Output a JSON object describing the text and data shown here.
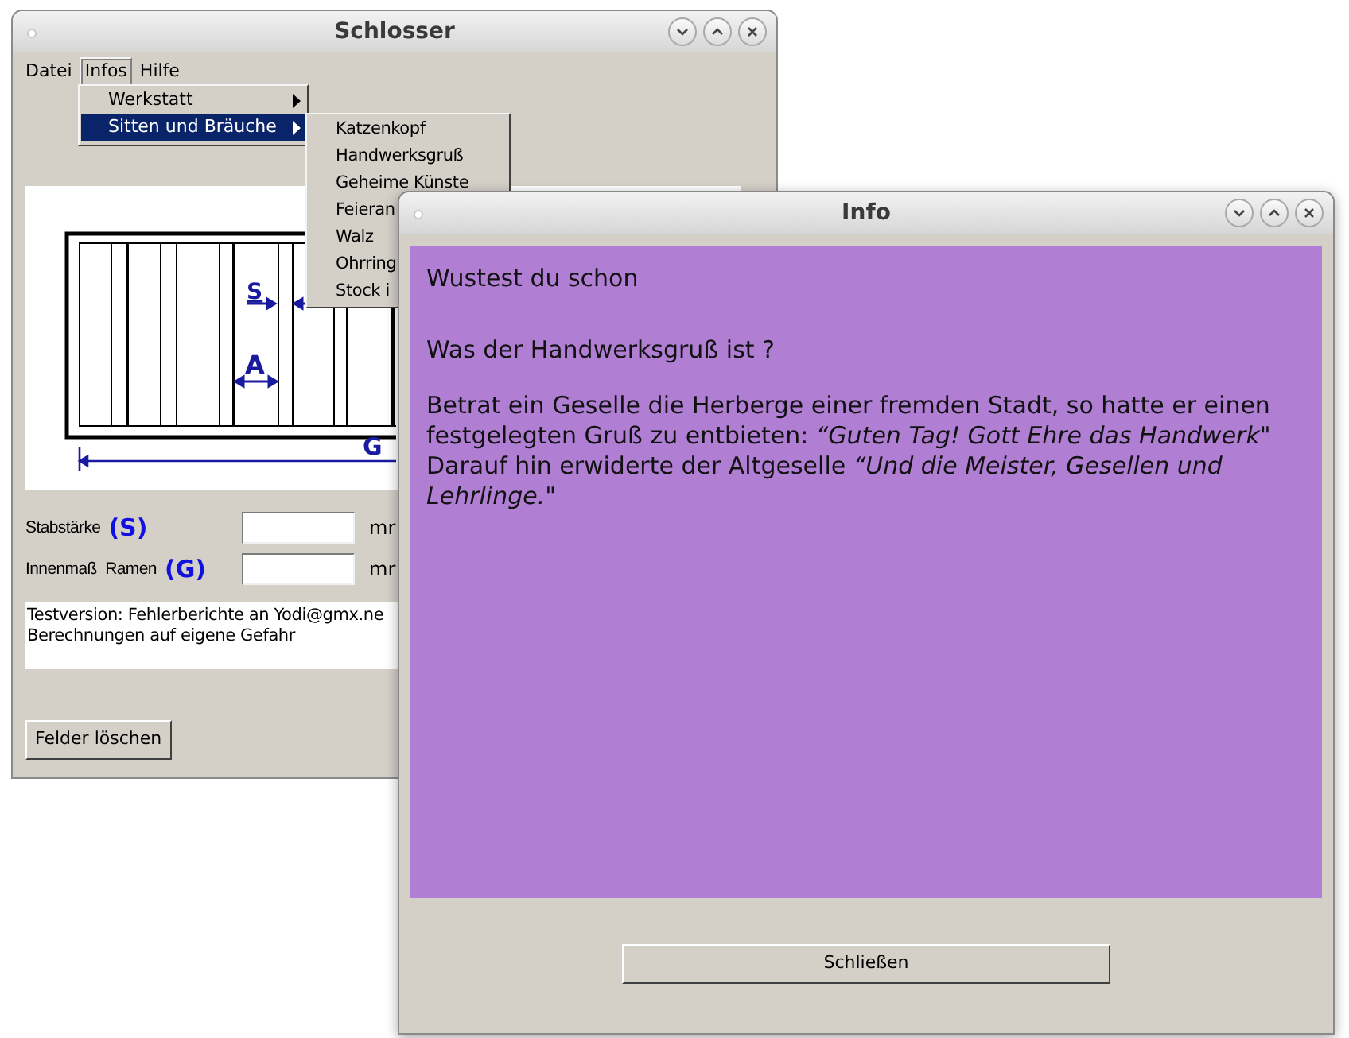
{
  "main_window": {
    "title": "Schlosser",
    "menu_bar": [
      {
        "label": "Datei",
        "selected": false
      },
      {
        "label": "Infos",
        "selected": true
      },
      {
        "label": "Hilfe",
        "selected": false
      }
    ],
    "menu": [
      {
        "label": "Werkstatt",
        "selected": false
      },
      {
        "label": "Sitten und Bräuche",
        "selected": true
      }
    ],
    "submenu": [
      "Katzenkopf",
      "Handwerksgruß",
      "Geheime Künste",
      "Feieran",
      "Walz",
      "Ohrring",
      "Stock i"
    ],
    "diagram": {
      "labels": [
        "S",
        "A",
        "G"
      ]
    },
    "fields": [
      {
        "label": "Stabstärke",
        "symbol": "(S)",
        "unit": "mr"
      },
      {
        "label": "Innenmaß  Ramen",
        "symbol": "(G)",
        "unit": "mr"
      }
    ],
    "notice": [
      "Testversion: Fehlerberichte an Yodi@gmx.ne",
      "Berechnungen auf eigene Gefahr"
    ],
    "button": "Felder löschen"
  },
  "info_window": {
    "title": "Info",
    "heading": "Wustest du schon",
    "question": "Was der Handwerksgruß ist ?",
    "paragraph": "Betrat ein Geselle die Herberge einer fremden Stadt, so hatte er einen festgelegten Gruß zu entbieten: *“Guten Tag! Gott Ehre das Handwerk*\"\nDarauf hin erwiderte der Altgeselle *“Und die Meister, Gesellen und Lehrlinge.*\"",
    "button": "Schließen"
  }
}
